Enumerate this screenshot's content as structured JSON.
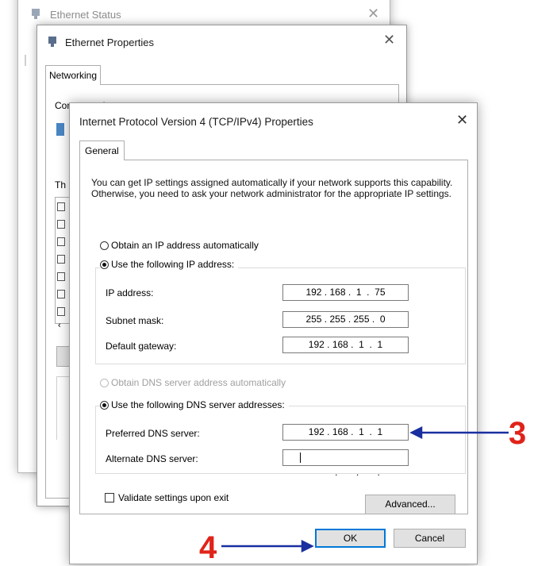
{
  "status_window": {
    "title": "Ethernet Status"
  },
  "properties_window": {
    "title": "Ethernet Properties",
    "tab_label": "Networking",
    "connect_using_fragment": "Connect using:",
    "this_connection_fragment": "Th"
  },
  "ipv4_dialog": {
    "title": "Internet Protocol Version 4 (TCP/IPv4) Properties",
    "tab_label": "General",
    "description": "You can get IP settings assigned automatically if your network supports this capability. Otherwise, you need to ask your network administrator for the appropriate IP settings.",
    "ip_auto_label": "Obtain an IP address automatically",
    "ip_manual_label": "Use the following IP address:",
    "ip_address_label": "IP address:",
    "ip_address_value": "192 . 168 .  1  .  75",
    "subnet_label": "Subnet mask:",
    "subnet_value": "255 . 255 . 255 .  0",
    "gateway_label": "Default gateway:",
    "gateway_value": "192 . 168 .  1  .  1",
    "dns_auto_label": "Obtain DNS server address automatically",
    "dns_manual_label": "Use the following DNS server addresses:",
    "preferred_dns_label": "Preferred DNS server:",
    "preferred_dns_value": "192 . 168 .  1  .  1",
    "alternate_dns_label": "Alternate DNS server:",
    "alternate_dns_value": "     .       .       .",
    "validate_label": "Validate settings upon exit",
    "advanced_button": "Advanced...",
    "ok_button": "OK",
    "cancel_button": "Cancel"
  },
  "annotations": {
    "step_3": "3",
    "step_4": "4",
    "arrow_color": "#1a2fa0",
    "number_color": "#e0231a"
  }
}
